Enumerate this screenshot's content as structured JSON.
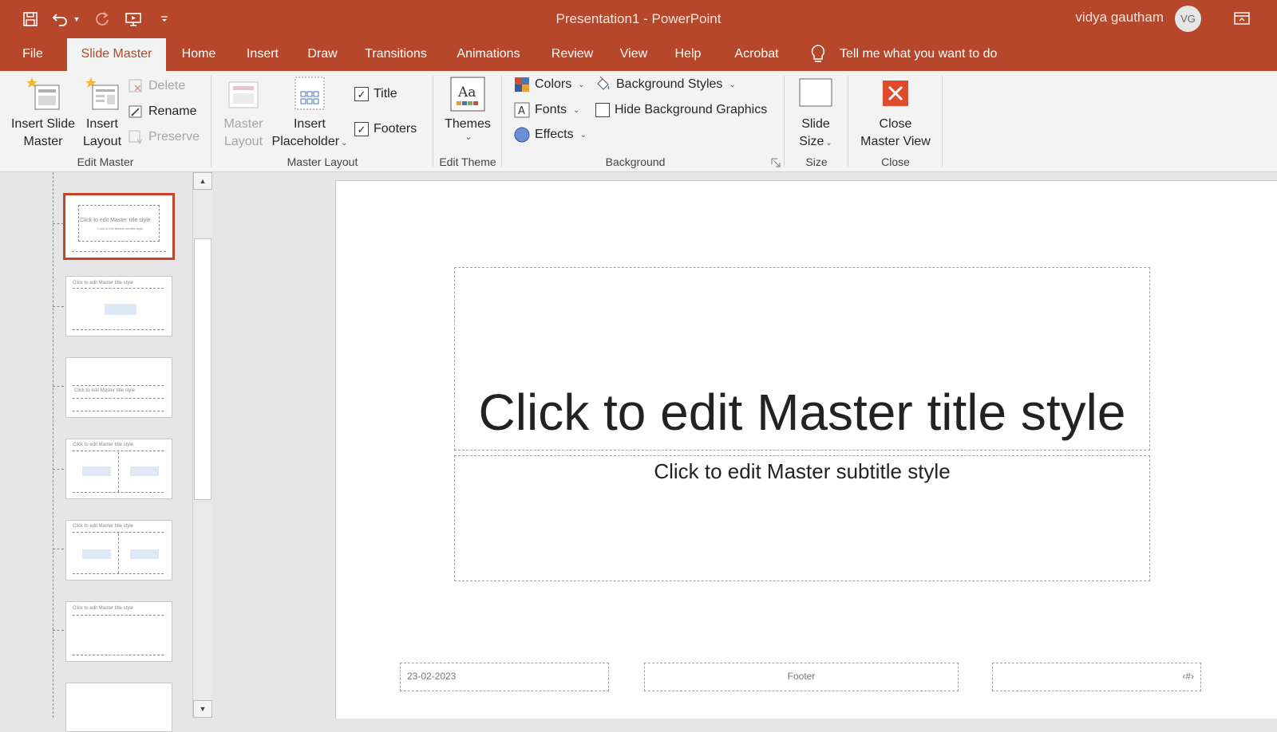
{
  "window": {
    "doc_title": "Presentation1  -  PowerPoint",
    "user_name": "vidya gautham",
    "user_initials": "VG"
  },
  "tabs": [
    {
      "label": "File"
    },
    {
      "label": "Slide Master"
    },
    {
      "label": "Home"
    },
    {
      "label": "Insert"
    },
    {
      "label": "Draw"
    },
    {
      "label": "Transitions"
    },
    {
      "label": "Animations"
    },
    {
      "label": "Review"
    },
    {
      "label": "View"
    },
    {
      "label": "Help"
    },
    {
      "label": "Acrobat"
    }
  ],
  "tell_me": "Tell me what you want to do",
  "ribbon": {
    "edit_master": {
      "group": "Edit Master",
      "insert_slide_master_1": "Insert Slide",
      "insert_slide_master_2": "Master",
      "insert_layout_1": "Insert",
      "insert_layout_2": "Layout",
      "delete": "Delete",
      "rename": "Rename",
      "preserve": "Preserve"
    },
    "master_layout": {
      "group": "Master Layout",
      "master_layout_1": "Master",
      "master_layout_2": "Layout",
      "insert_placeholder_1": "Insert",
      "insert_placeholder_2": "Placeholder",
      "title": "Title",
      "footers": "Footers",
      "title_checked": true,
      "footers_checked": true
    },
    "edit_theme": {
      "group": "Edit Theme",
      "themes": "Themes"
    },
    "background": {
      "group": "Background",
      "colors": "Colors",
      "fonts": "Fonts",
      "effects": "Effects",
      "background_styles": "Background Styles",
      "hide_background_graphics": "Hide Background Graphics",
      "hide_checked": false
    },
    "size": {
      "group": "Size",
      "slide_size_1": "Slide",
      "slide_size_2": "Size"
    },
    "close": {
      "group": "Close",
      "close_master_view_1": "Close",
      "close_master_view_2": "Master View"
    }
  },
  "thumbnails": [
    {
      "title": "Click to edit Master title style",
      "subtitle": "Click to edit Master subtitle style"
    },
    {
      "title": "Click to edit Master title style"
    },
    {
      "title": "Click to edit Master title style"
    },
    {
      "title": "Click to edit Master title style"
    },
    {
      "title": "Click to edit Master title style"
    },
    {
      "title": "Click to edit Master title style"
    }
  ],
  "slide": {
    "title": "Click to edit Master title style",
    "subtitle": "Click to edit Master subtitle style",
    "date": "23-02-2023",
    "footer": "Footer",
    "slide_number": "‹#›"
  },
  "colors": {
    "accent": "#b7472a",
    "ribbon_bg": "#f3f3f3",
    "selected_thumb_border": "#c5452b"
  }
}
